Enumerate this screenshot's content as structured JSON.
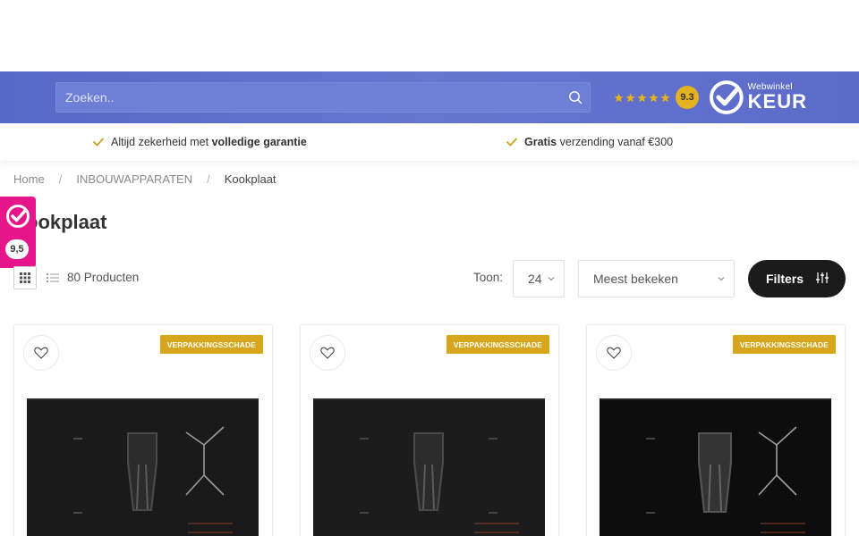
{
  "header": {
    "search_placeholder": "Zoeken..",
    "rating_score": "9.3",
    "rating_stars": 5,
    "keurmerk_small": "Webwinkel",
    "keurmerk_big": "KEUR"
  },
  "usps": {
    "left_pre": "Altijd zekerheid met ",
    "left_bold": "volledige garantie",
    "right_bold": "Gratis",
    "right_post": " verzending vanaf €300"
  },
  "breadcrumb": {
    "home": "Home",
    "sep1": "/",
    "category": "INBOUWAPPARATEN",
    "sep2": "/",
    "current": "Kookplaat"
  },
  "side_badge": {
    "score": "9,5"
  },
  "page": {
    "title": "ookplaat"
  },
  "toolbar": {
    "count": "80 Producten",
    "toon_label": "Toon:",
    "toon_value": "24",
    "sort_value": "Meest bekeken",
    "filters_label": "Filters"
  },
  "products": [
    {
      "tag": "VERPAKKINGSSCHADE"
    },
    {
      "tag": "VERPAKKINGSSCHADE"
    },
    {
      "tag": "VERPAKKINGSSCHADE"
    }
  ],
  "colors": {
    "header_blue": "#5b6bc8",
    "badge_pink": "#e6168a",
    "tag_gold": "#d8a61c",
    "check_gold": "#c9a227"
  }
}
